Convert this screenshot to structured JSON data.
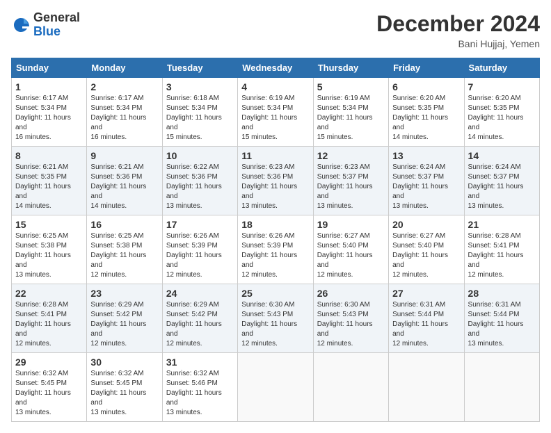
{
  "logo": {
    "general": "General",
    "blue": "Blue"
  },
  "title": "December 2024",
  "location": "Bani Hujjaj, Yemen",
  "days_of_week": [
    "Sunday",
    "Monday",
    "Tuesday",
    "Wednesday",
    "Thursday",
    "Friday",
    "Saturday"
  ],
  "weeks": [
    [
      {
        "num": "1",
        "sunrise": "6:17 AM",
        "sunset": "5:34 PM",
        "daylight": "11 hours and 16 minutes."
      },
      {
        "num": "2",
        "sunrise": "6:17 AM",
        "sunset": "5:34 PM",
        "daylight": "11 hours and 16 minutes."
      },
      {
        "num": "3",
        "sunrise": "6:18 AM",
        "sunset": "5:34 PM",
        "daylight": "11 hours and 15 minutes."
      },
      {
        "num": "4",
        "sunrise": "6:19 AM",
        "sunset": "5:34 PM",
        "daylight": "11 hours and 15 minutes."
      },
      {
        "num": "5",
        "sunrise": "6:19 AM",
        "sunset": "5:34 PM",
        "daylight": "11 hours and 15 minutes."
      },
      {
        "num": "6",
        "sunrise": "6:20 AM",
        "sunset": "5:35 PM",
        "daylight": "11 hours and 14 minutes."
      },
      {
        "num": "7",
        "sunrise": "6:20 AM",
        "sunset": "5:35 PM",
        "daylight": "11 hours and 14 minutes."
      }
    ],
    [
      {
        "num": "8",
        "sunrise": "6:21 AM",
        "sunset": "5:35 PM",
        "daylight": "11 hours and 14 minutes."
      },
      {
        "num": "9",
        "sunrise": "6:21 AM",
        "sunset": "5:36 PM",
        "daylight": "11 hours and 14 minutes."
      },
      {
        "num": "10",
        "sunrise": "6:22 AM",
        "sunset": "5:36 PM",
        "daylight": "11 hours and 13 minutes."
      },
      {
        "num": "11",
        "sunrise": "6:23 AM",
        "sunset": "5:36 PM",
        "daylight": "11 hours and 13 minutes."
      },
      {
        "num": "12",
        "sunrise": "6:23 AM",
        "sunset": "5:37 PM",
        "daylight": "11 hours and 13 minutes."
      },
      {
        "num": "13",
        "sunrise": "6:24 AM",
        "sunset": "5:37 PM",
        "daylight": "11 hours and 13 minutes."
      },
      {
        "num": "14",
        "sunrise": "6:24 AM",
        "sunset": "5:37 PM",
        "daylight": "11 hours and 13 minutes."
      }
    ],
    [
      {
        "num": "15",
        "sunrise": "6:25 AM",
        "sunset": "5:38 PM",
        "daylight": "11 hours and 13 minutes."
      },
      {
        "num": "16",
        "sunrise": "6:25 AM",
        "sunset": "5:38 PM",
        "daylight": "11 hours and 12 minutes."
      },
      {
        "num": "17",
        "sunrise": "6:26 AM",
        "sunset": "5:39 PM",
        "daylight": "11 hours and 12 minutes."
      },
      {
        "num": "18",
        "sunrise": "6:26 AM",
        "sunset": "5:39 PM",
        "daylight": "11 hours and 12 minutes."
      },
      {
        "num": "19",
        "sunrise": "6:27 AM",
        "sunset": "5:40 PM",
        "daylight": "11 hours and 12 minutes."
      },
      {
        "num": "20",
        "sunrise": "6:27 AM",
        "sunset": "5:40 PM",
        "daylight": "11 hours and 12 minutes."
      },
      {
        "num": "21",
        "sunrise": "6:28 AM",
        "sunset": "5:41 PM",
        "daylight": "11 hours and 12 minutes."
      }
    ],
    [
      {
        "num": "22",
        "sunrise": "6:28 AM",
        "sunset": "5:41 PM",
        "daylight": "11 hours and 12 minutes."
      },
      {
        "num": "23",
        "sunrise": "6:29 AM",
        "sunset": "5:42 PM",
        "daylight": "11 hours and 12 minutes."
      },
      {
        "num": "24",
        "sunrise": "6:29 AM",
        "sunset": "5:42 PM",
        "daylight": "11 hours and 12 minutes."
      },
      {
        "num": "25",
        "sunrise": "6:30 AM",
        "sunset": "5:43 PM",
        "daylight": "11 hours and 12 minutes."
      },
      {
        "num": "26",
        "sunrise": "6:30 AM",
        "sunset": "5:43 PM",
        "daylight": "11 hours and 12 minutes."
      },
      {
        "num": "27",
        "sunrise": "6:31 AM",
        "sunset": "5:44 PM",
        "daylight": "11 hours and 12 minutes."
      },
      {
        "num": "28",
        "sunrise": "6:31 AM",
        "sunset": "5:44 PM",
        "daylight": "11 hours and 13 minutes."
      }
    ],
    [
      {
        "num": "29",
        "sunrise": "6:32 AM",
        "sunset": "5:45 PM",
        "daylight": "11 hours and 13 minutes."
      },
      {
        "num": "30",
        "sunrise": "6:32 AM",
        "sunset": "5:45 PM",
        "daylight": "11 hours and 13 minutes."
      },
      {
        "num": "31",
        "sunrise": "6:32 AM",
        "sunset": "5:46 PM",
        "daylight": "11 hours and 13 minutes."
      },
      null,
      null,
      null,
      null
    ]
  ]
}
